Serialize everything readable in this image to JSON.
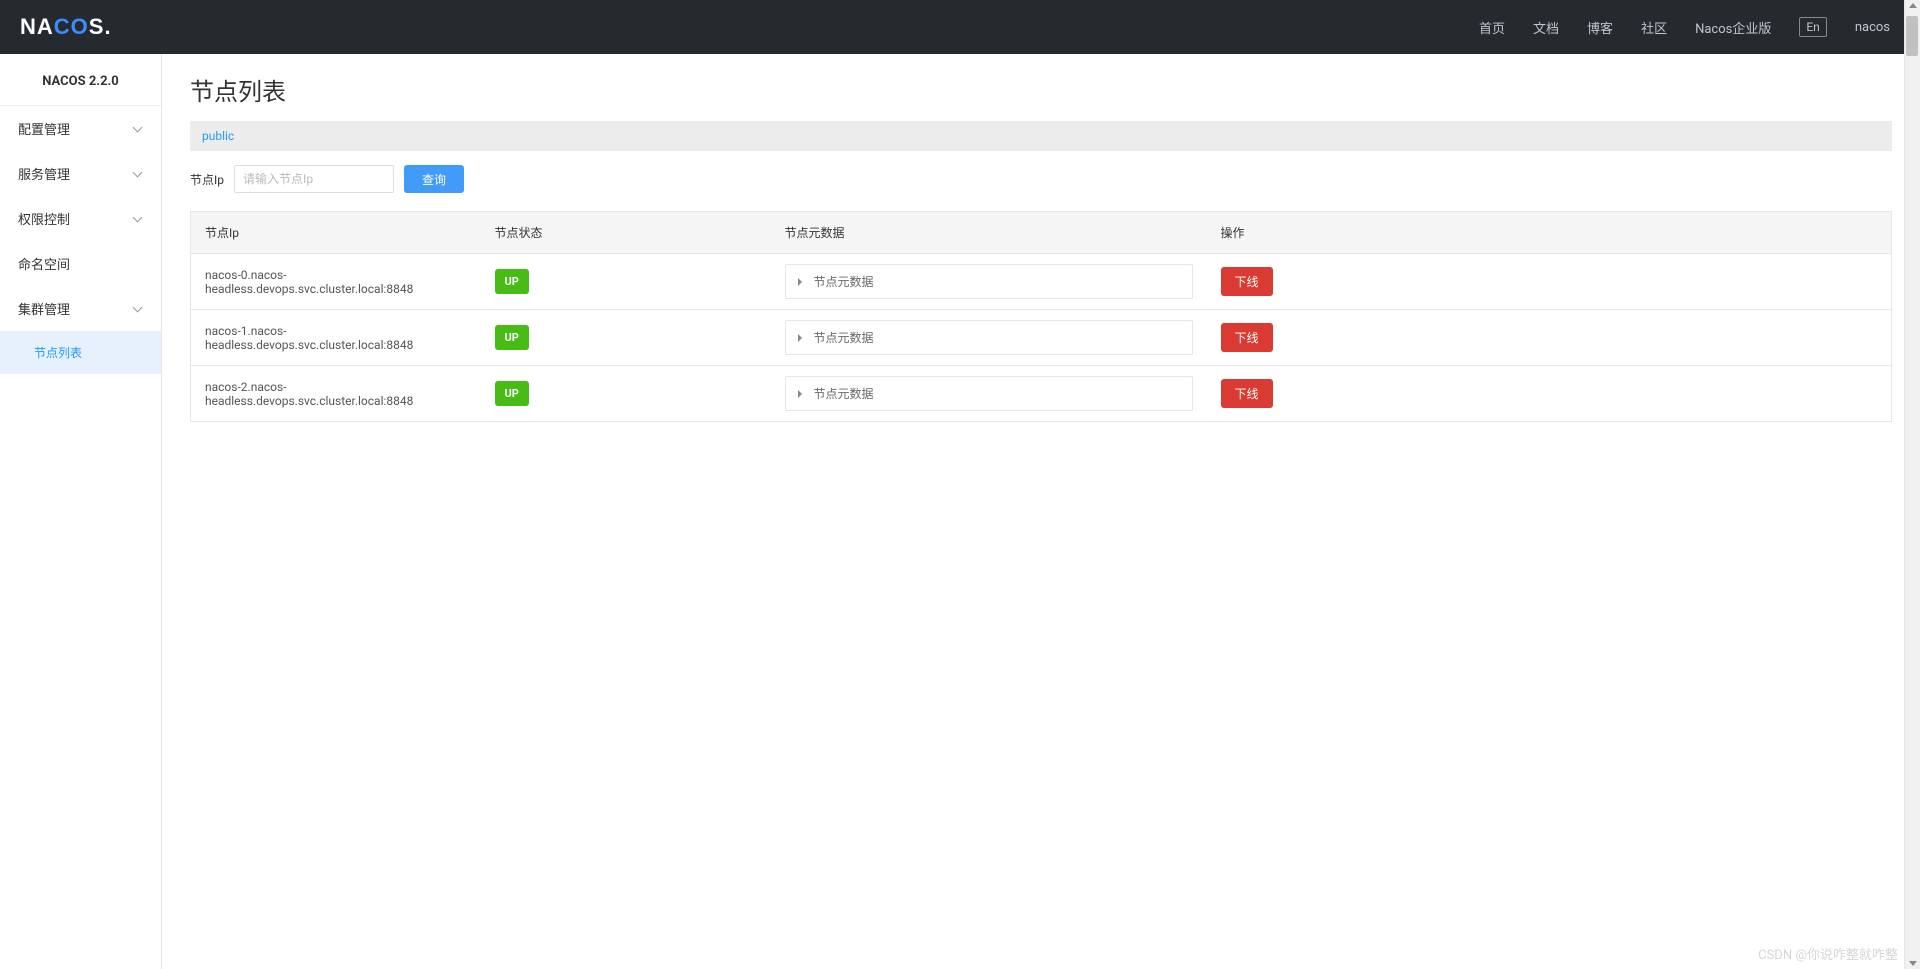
{
  "header": {
    "logo": {
      "prefix": "NA",
      "accent": "CO",
      "suffix": "S",
      "dot": "."
    },
    "nav": {
      "home": "首页",
      "docs": "文档",
      "blog": "博客",
      "community": "社区",
      "enterprise": "Nacos企业版",
      "lang": "En",
      "user": "nacos"
    }
  },
  "sidebar": {
    "version": "NACOS 2.2.0",
    "items": [
      {
        "label": "配置管理"
      },
      {
        "label": "服务管理"
      },
      {
        "label": "权限控制"
      },
      {
        "label": "命名空间"
      },
      {
        "label": "集群管理"
      }
    ],
    "submenu": {
      "node_list": "节点列表"
    }
  },
  "page": {
    "title": "节点列表",
    "namespace": "public",
    "search": {
      "label": "节点Ip",
      "placeholder": "请输入节点Ip",
      "button": "查询"
    }
  },
  "table": {
    "headers": {
      "ip": "节点Ip",
      "status": "节点状态",
      "meta": "节点元数据",
      "action": "操作"
    },
    "meta_label": "节点元数据",
    "offline_label": "下线",
    "rows": [
      {
        "ip": "nacos-0.nacos-headless.devops.svc.cluster.local:8848",
        "status": "UP"
      },
      {
        "ip": "nacos-1.nacos-headless.devops.svc.cluster.local:8848",
        "status": "UP"
      },
      {
        "ip": "nacos-2.nacos-headless.devops.svc.cluster.local:8848",
        "status": "UP"
      }
    ]
  },
  "watermark": "CSDN @你说咋整就咋整"
}
